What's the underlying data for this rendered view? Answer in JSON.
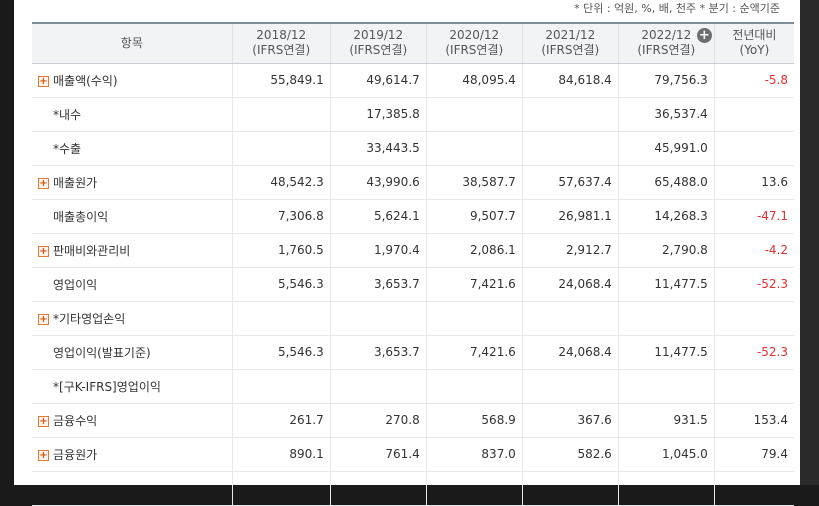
{
  "unit_note": "* 단위 : 억원, %, 배, 천주    * 분기 : 순액기준",
  "header": {
    "item": "항목",
    "periods": [
      {
        "year": "2018/12",
        "basis": "(IFRS연결)"
      },
      {
        "year": "2019/12",
        "basis": "(IFRS연결)"
      },
      {
        "year": "2020/12",
        "basis": "(IFRS연결)"
      },
      {
        "year": "2021/12",
        "basis": "(IFRS연결)"
      },
      {
        "year": "2022/12",
        "basis": "(IFRS연결)"
      }
    ],
    "yoy_line1": "전년대비",
    "yoy_line2": "(YoY)",
    "expand_icon": "plus-circle-icon"
  },
  "rows": [
    {
      "label": "매출액(수익)",
      "expandable": true,
      "values": [
        "55,849.1",
        "49,614.7",
        "48,095.4",
        "84,618.4",
        "79,756.3"
      ],
      "yoy": "-5.8"
    },
    {
      "label": "*내수",
      "expandable": false,
      "values": [
        "",
        "17,385.8",
        "",
        "",
        "36,537.4"
      ],
      "yoy": ""
    },
    {
      "label": "*수출",
      "expandable": false,
      "values": [
        "",
        "33,443.5",
        "",
        "",
        "45,991.0"
      ],
      "yoy": ""
    },
    {
      "label": "매출원가",
      "expandable": true,
      "values": [
        "48,542.3",
        "43,990.6",
        "38,587.7",
        "57,637.4",
        "65,488.0"
      ],
      "yoy": "13.6"
    },
    {
      "label": "매출총이익",
      "expandable": false,
      "values": [
        "7,306.8",
        "5,624.1",
        "9,507.7",
        "26,981.1",
        "14,268.3"
      ],
      "yoy": "-47.1"
    },
    {
      "label": "판매비와관리비",
      "expandable": true,
      "values": [
        "1,760.5",
        "1,970.4",
        "2,086.1",
        "2,912.7",
        "2,790.8"
      ],
      "yoy": "-4.2"
    },
    {
      "label": "영업이익",
      "expandable": false,
      "values": [
        "5,546.3",
        "3,653.7",
        "7,421.6",
        "24,068.4",
        "11,477.5"
      ],
      "yoy": "-52.3"
    },
    {
      "label": "*기타영업손익",
      "expandable": true,
      "values": [
        "",
        "",
        "",
        "",
        ""
      ],
      "yoy": ""
    },
    {
      "label": "영업이익(발표기준)",
      "expandable": false,
      "values": [
        "5,546.3",
        "3,653.7",
        "7,421.6",
        "24,068.4",
        "11,477.5"
      ],
      "yoy": "-52.3"
    },
    {
      "label": "*[구K-IFRS]영업이익",
      "expandable": false,
      "values": [
        "",
        "",
        "",
        "",
        ""
      ],
      "yoy": ""
    },
    {
      "label": "금융수익",
      "expandable": true,
      "values": [
        "261.7",
        "270.8",
        "568.9",
        "367.6",
        "931.5"
      ],
      "yoy": "153.4"
    },
    {
      "label": "금융원가",
      "expandable": true,
      "values": [
        "890.1",
        "761.4",
        "837.0",
        "582.6",
        "1,045.0"
      ],
      "yoy": "79.4"
    },
    {
      "label": "",
      "expandable": false,
      "values": [
        "",
        "",
        "",
        "",
        ""
      ],
      "yoy": ""
    }
  ]
}
